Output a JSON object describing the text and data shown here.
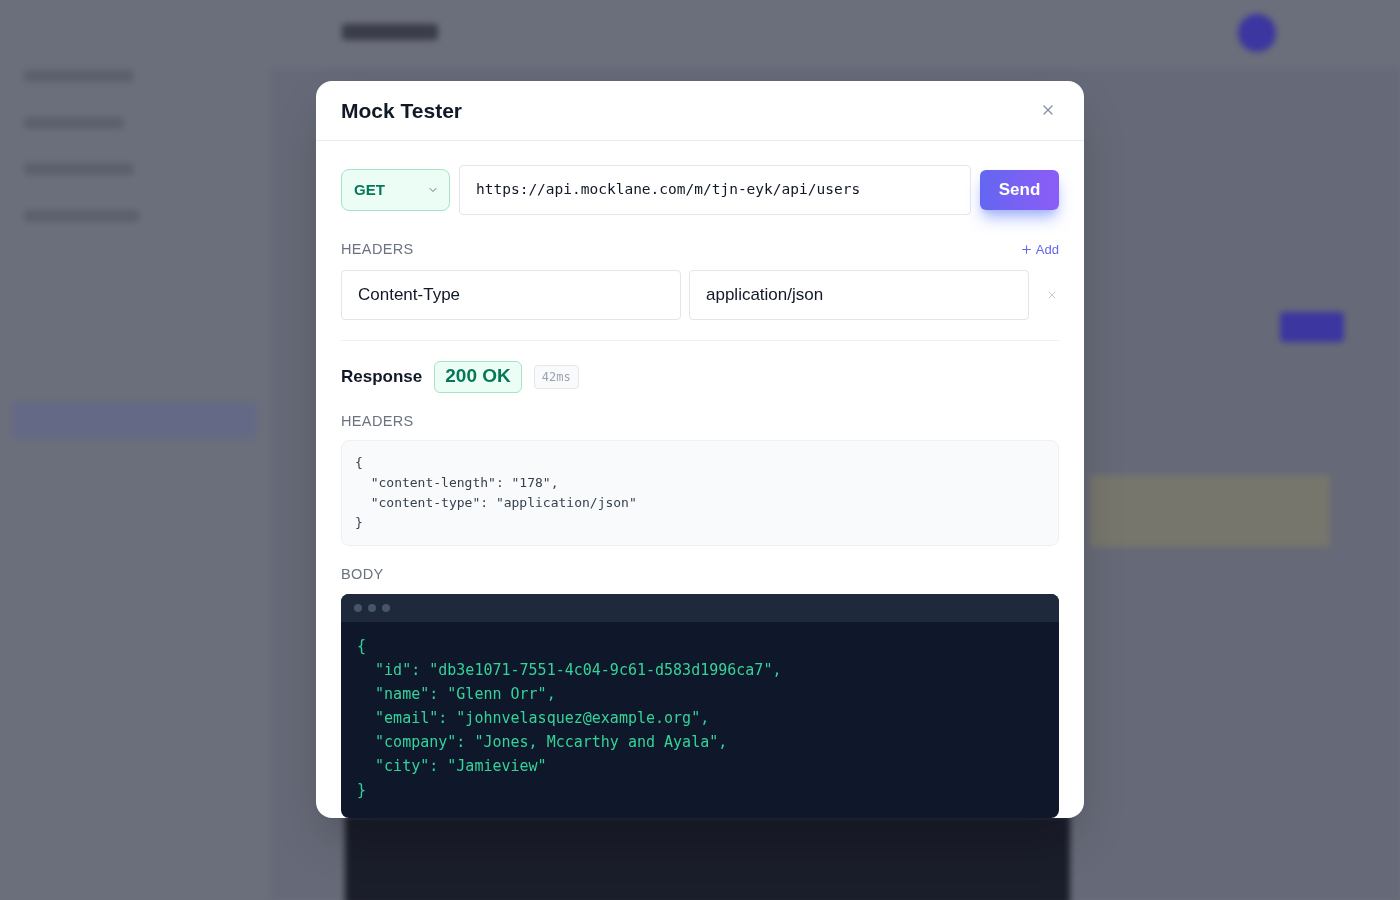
{
  "dialog": {
    "title": "Mock Tester"
  },
  "request": {
    "method": "GET",
    "url": "https://api.mocklane.com/m/tjn-eyk/api/users",
    "send_label": "Send"
  },
  "request_headers": {
    "label": "HEADERS",
    "add_label": "Add",
    "rows": [
      {
        "key": "Content-Type",
        "value": "application/json"
      }
    ]
  },
  "response": {
    "label": "Response",
    "status": "200 OK",
    "success": true,
    "time": "42ms",
    "headers_label": "HEADERS",
    "headers_lines": [
      "{",
      "  \"content-length\": \"178\",",
      "  \"content-type\": \"application/json\"",
      "}"
    ],
    "body_label": "BODY",
    "body_lines": [
      "{",
      "  \"id\": \"db3e1071-7551-4c04-9c61-d583d1996ca7\",",
      "  \"name\": \"Glenn Orr\",",
      "  \"email\": \"johnvelasquez@example.org\",",
      "  \"company\": \"Jones, Mccarthy and Ayala\",",
      "  \"city\": \"Jamieview\"",
      "}"
    ]
  }
}
